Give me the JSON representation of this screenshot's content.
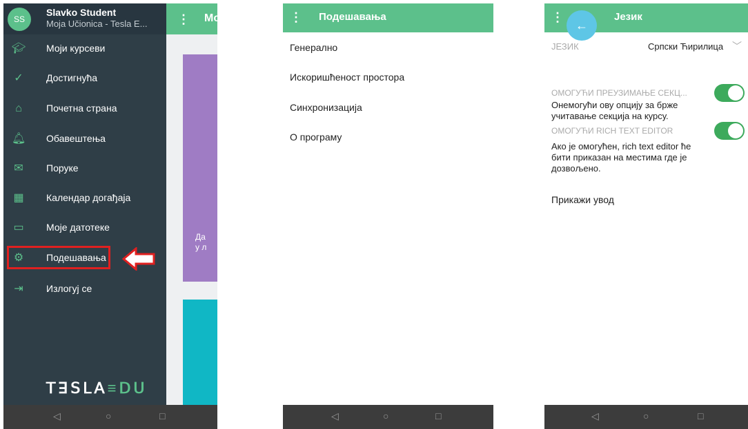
{
  "phone1": {
    "header_title": "Мо",
    "user": {
      "initials": "SS",
      "name": "Slavko Student",
      "site": "Moja Učionica - Tesla E..."
    },
    "menu": [
      {
        "label": "Моји курсеви",
        "icon": "courses-icon"
      },
      {
        "label": "Достигнућа",
        "icon": "checkmark-icon"
      },
      {
        "label": "Почетна страна",
        "icon": "home-cap-icon"
      },
      {
        "label": "Обавештења",
        "icon": "bell-icon"
      },
      {
        "label": "Поруке",
        "icon": "envelope-icon"
      },
      {
        "label": "Календар догађаја",
        "icon": "calendar-icon"
      },
      {
        "label": "Моје датотеке",
        "icon": "folder-icon"
      },
      {
        "label": "Подешавања",
        "icon": "gear-icon"
      },
      {
        "label": "Излогуј се",
        "icon": "logout-icon"
      }
    ],
    "card_text_1": "Да",
    "card_text_2": "у л",
    "logo": "TESLA EDU"
  },
  "phone2": {
    "title": "Подешавања",
    "items": [
      "Генерално",
      "Искоришћеност простора",
      "Синхронизација",
      "О програму"
    ]
  },
  "phone3": {
    "title": "Језик",
    "language_label": "ЈЕЗИК",
    "language_value": "Српски Ћирилица",
    "option1_title": "ОМОГУЋИ ПРЕУЗИМАЊЕ СЕКЦ...",
    "option1_desc": "Онемогући ову опцију за брже учитавање секција на курсу.",
    "option1_on": true,
    "option2_title": "ОМОГУЋИ RICH TEXT EDITOR",
    "option2_desc": "Ако је омогућен, rich text editor ће бити приказан на местима где је дозвољено.",
    "option2_on": true,
    "intro": "Прикажи увод"
  },
  "colors": {
    "accent": "#5cc08b",
    "drawer": "#2f3e47",
    "highlight": "#e02020",
    "purple": "#9f7cc4",
    "teal": "#10b7c5",
    "back_button": "#5ec6e6"
  }
}
